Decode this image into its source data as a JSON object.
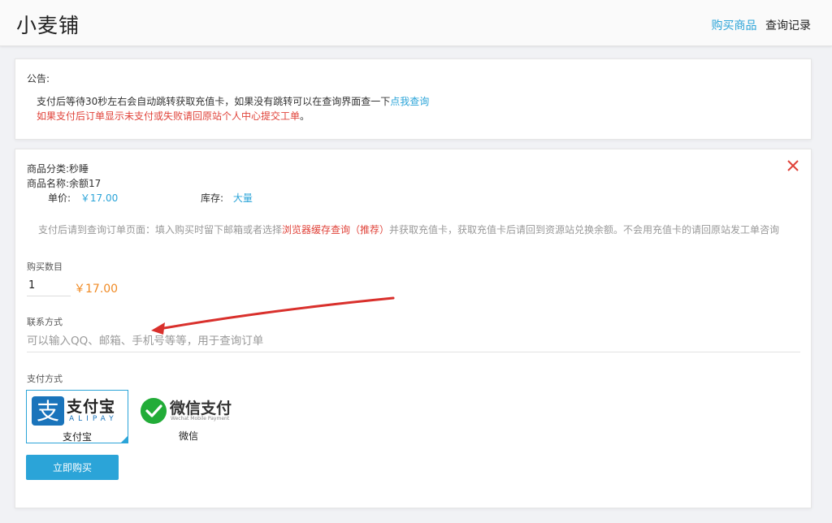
{
  "header": {
    "brand": "小麦铺",
    "nav": [
      {
        "label": "购买商品"
      },
      {
        "label": "查询记录"
      }
    ]
  },
  "notice": {
    "label": "公告:",
    "line1_text": "支付后等待30秒左右会自动跳转获取充值卡，如果没有跳转可以在查询界面查一下",
    "line1_link": "点我查询",
    "line2_text": "如果支付后订单显示未支付或失败请回原站个人中心提交工单",
    "line2_dot": "。"
  },
  "product": {
    "category_label": "商品分类:",
    "category_value": "秒睡",
    "name_label": "商品名称:",
    "name_value": "余额17",
    "price_label": "单价:",
    "price_value": "￥17.00",
    "stock_label": "库存:",
    "stock_value": "大量"
  },
  "tip": {
    "before": "支付后请到查询订单页面：填入购买时留下邮箱或者选择",
    "highlight": "浏览器缓存查询（推荐）",
    "after": "并获取充值卡，获取充值卡后请回到资源站兑换余额。不会用充值卡的请回原站发工单咨询"
  },
  "form": {
    "quantity_label": "购买数目",
    "quantity_value": "1",
    "total_price": "￥17.00",
    "contact_label": "联系方式",
    "contact_placeholder": "可以输入QQ、邮箱、手机号等等，用于查询订单",
    "payment_label": "支付方式",
    "payment_options": [
      {
        "logo_text": "支付宝",
        "logo_sub": "ALIPAY",
        "caption": "支付宝"
      },
      {
        "logo_text": "微信支付",
        "logo_sub": "Wechat Mobile Payment",
        "caption": "微信"
      }
    ],
    "buy_label": "立即购买"
  },
  "colors": {
    "accent": "#2ba4d8",
    "warning": "#e0433a",
    "price": "#f08a24",
    "alipay": "#1a74bb",
    "wechat": "#22ac38"
  }
}
